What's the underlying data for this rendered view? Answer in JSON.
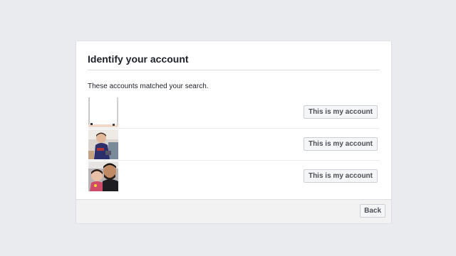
{
  "dialog": {
    "title": "Identify your account",
    "subtitle": "These accounts matched your search."
  },
  "accounts": [
    {
      "avatar_icon": "blank-profile-photo",
      "button_label": "This is my account"
    },
    {
      "avatar_icon": "child-photo",
      "button_label": "This is my account"
    },
    {
      "avatar_icon": "family-selfie-photo",
      "button_label": "This is my account"
    }
  ],
  "footer": {
    "back_label": "Back"
  },
  "colors": {
    "page_background": "#e9ebee",
    "button_background": "#f5f6f7",
    "button_border": "#ccd0d5",
    "button_text": "#4b4f56",
    "footer_background": "#f2f2f2"
  }
}
